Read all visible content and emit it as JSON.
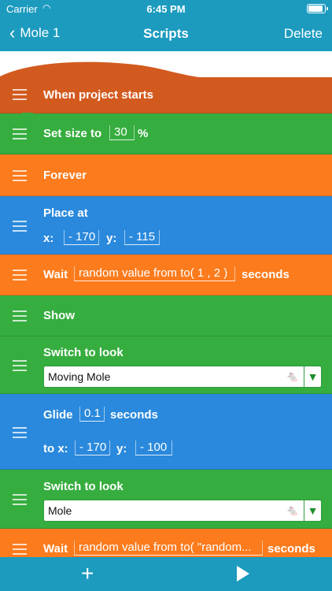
{
  "status_bar": {
    "carrier": "Carrier",
    "time": "6:45 PM"
  },
  "nav": {
    "back_label": "Mole 1",
    "title": "Scripts",
    "delete_label": "Delete"
  },
  "bricks": [
    {
      "type": "when-project-starts",
      "label": "When project starts",
      "color": "#d35a1f"
    },
    {
      "type": "set-size",
      "label": "Set size to",
      "value": "30",
      "suffix": "%",
      "color": "#36ad3f"
    },
    {
      "type": "forever",
      "label": "Forever",
      "color": "#fb7b1d"
    },
    {
      "type": "place-at",
      "label": "Place at",
      "x_label": "x:",
      "x_value": "- 170",
      "y_label": "y:",
      "y_value": "- 115",
      "color": "#2a89dc"
    },
    {
      "type": "wait",
      "label": "Wait",
      "value": "random value from to( 1 , 2 )",
      "suffix": "seconds",
      "color": "#fb7b1d"
    },
    {
      "type": "show",
      "label": "Show",
      "color": "#36ad3f"
    },
    {
      "type": "switch-look",
      "label": "Switch to look",
      "look": "Moving Mole",
      "color": "#36ad3f"
    },
    {
      "type": "glide",
      "label": "Glide",
      "value": "0.1",
      "suffix": "seconds",
      "to_x_label": "to x:",
      "x_value": "- 170",
      "y_label": "y:",
      "y_value": "- 100",
      "color": "#2a89dc"
    },
    {
      "type": "switch-look",
      "label": "Switch to look",
      "look": "Mole",
      "color": "#36ad3f"
    },
    {
      "type": "wait",
      "label": "Wait",
      "value": "random value from to( \"random...",
      "suffix": "seconds",
      "color": "#fb7b1d"
    }
  ],
  "toolbar": {
    "add_icon": "plus-icon",
    "play_icon": "play-icon"
  }
}
